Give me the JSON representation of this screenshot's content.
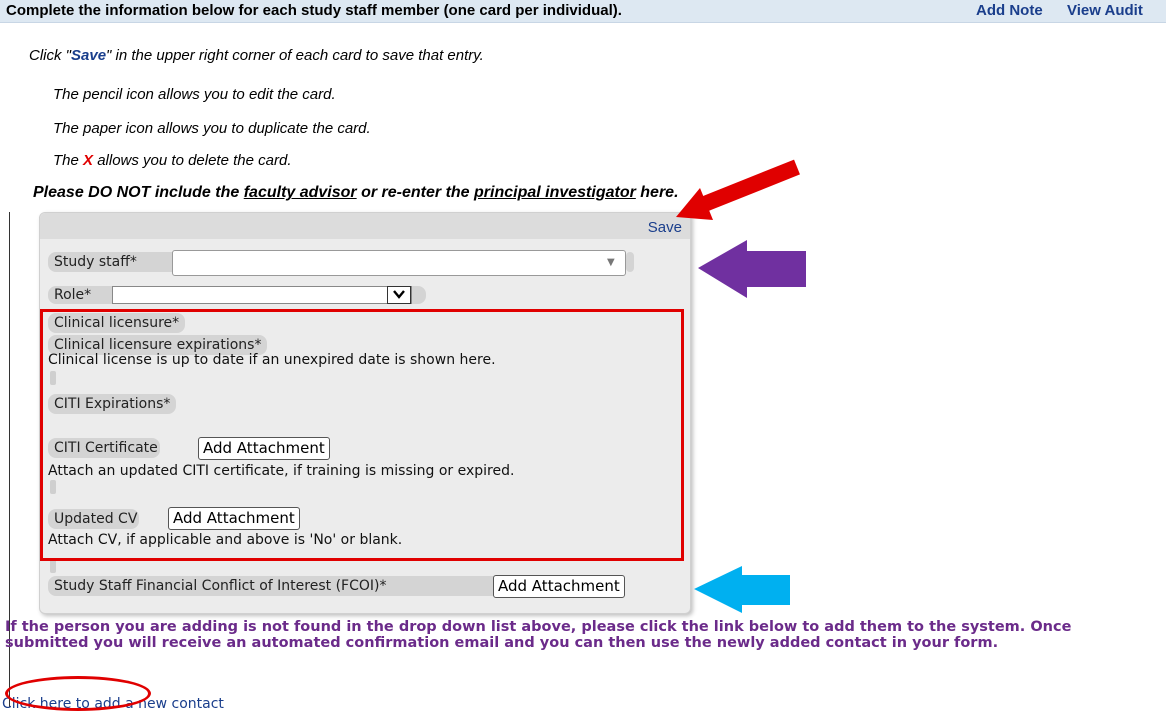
{
  "header": {
    "title": "Complete the information below for each study staff member (one card per individual).",
    "add_note": "Add Note",
    "view_audit": "View Audit"
  },
  "instructions": {
    "save_line_prefix": "Click \"",
    "save_word": "Save",
    "save_line_suffix": "\" in the upper right corner of each card to save that entry.",
    "pencil_line": "The pencil icon allows you to edit the card.",
    "paper_line": "The paper icon allows you to duplicate the card.",
    "x_line_prefix": "The ",
    "x_char": "X",
    "x_line_suffix": " allows you to delete the card.",
    "warning_prefix": "Please DO NOT include the ",
    "warning_faculty": "faculty advisor",
    "warning_mid": " or re-enter the ",
    "warning_pi": "principal investigator",
    "warning_suffix": " here."
  },
  "card": {
    "save_label": "Save",
    "study_staff_label": "Study staff*",
    "study_staff_value": "",
    "role_label": "Role*",
    "role_value": "",
    "clinical_licensure_label": "Clinical licensure*",
    "clinical_expirations_label": "Clinical licensure expirations*",
    "clinical_expirations_note": "Clinical license is up to date if an unexpired date is shown here.",
    "citi_expirations_label": "CITI Expirations*",
    "citi_certificate_label": "CITI Certificate",
    "citi_attach_label": "Add Attachment",
    "citi_note": "Attach an updated CITI certificate, if training is missing or expired.",
    "cv_label": "Updated CV",
    "cv_attach_label": "Add Attachment",
    "cv_note": "Attach CV, if applicable and above is 'No' or blank.",
    "fcoi_label": "Study Staff Financial Conflict of Interest (FCOI)*",
    "fcoi_attach_label": "Add Attachment"
  },
  "footer": {
    "note": "If the person you are adding is not found in the drop down list above, please click the link below to add them to the system. Once submitted you will receive an automated confirmation email and you can then use the newly added contact in your form.",
    "add_contact_link": "Click here to add a new contact"
  },
  "colors": {
    "annotation_red": "#e00000",
    "annotation_purple": "#7030a0",
    "annotation_blue": "#00b0f0",
    "link_blue": "#1a3e8c",
    "footer_purple": "#6b2b8a"
  }
}
